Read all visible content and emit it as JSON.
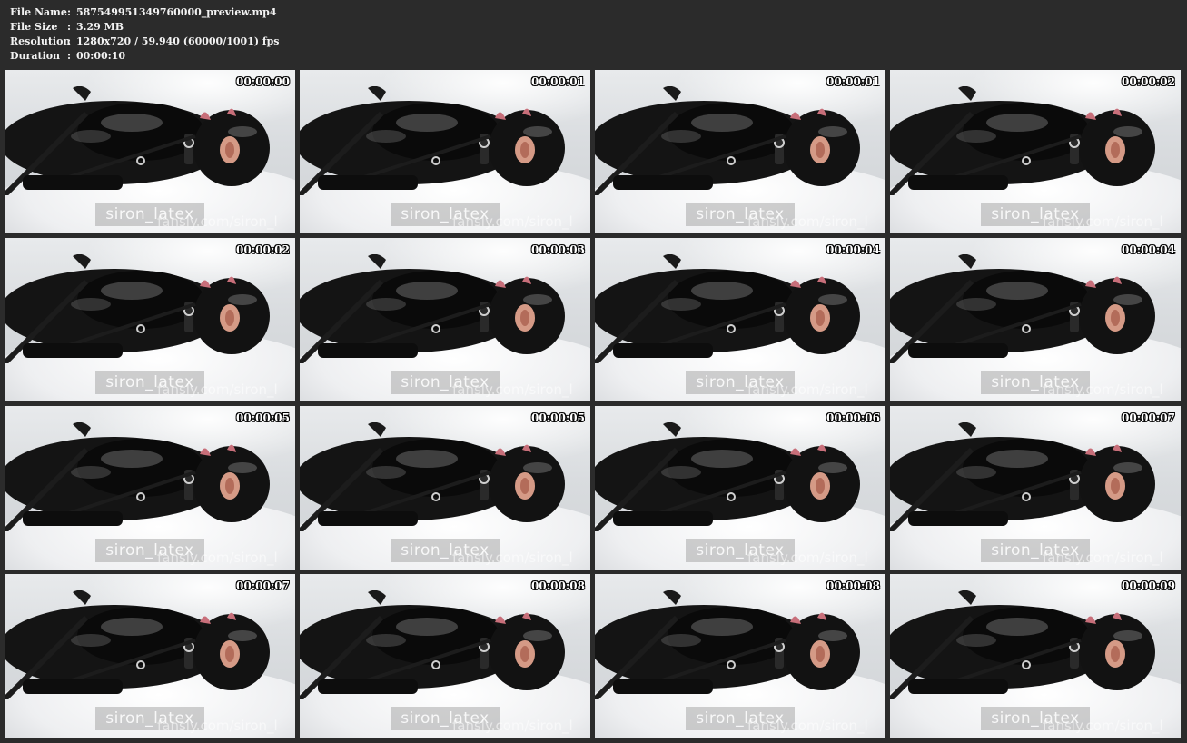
{
  "info": [
    {
      "key": "File Name",
      "value": "587549951349760000_preview.mp4"
    },
    {
      "key": "File Size",
      "value": "3.29 MB"
    },
    {
      "key": "Resolution",
      "value": "1280x720 / 59.940 (60000/1001) fps"
    },
    {
      "key": "Duration",
      "value": "00:00:10"
    }
  ],
  "watermark": {
    "primary": "siron_latex",
    "secondary": "fansly.com/siron_l"
  },
  "thumbnails": [
    "00:00:00",
    "00:00:01",
    "00:00:01",
    "00:00:02",
    "00:00:02",
    "00:00:03",
    "00:00:04",
    "00:00:04",
    "00:00:05",
    "00:00:05",
    "00:00:06",
    "00:00:07",
    "00:00:07",
    "00:00:08",
    "00:00:08",
    "00:00:09"
  ],
  "colors": {
    "background": "#2b2b2b",
    "text": "#f2f2f2",
    "timestamp": "#ffffff"
  }
}
